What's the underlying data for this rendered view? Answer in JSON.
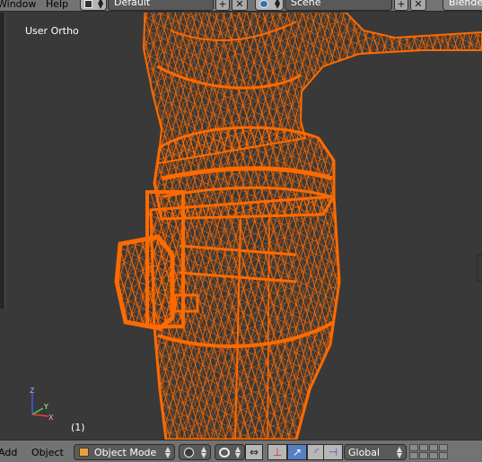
{
  "info_header": {
    "menus": [
      "Window",
      "Help"
    ],
    "layout": {
      "icon": "screen-layout-icon",
      "value": "Default"
    },
    "scene": {
      "icon": "scene-icon",
      "value": "Scene"
    },
    "add_label": "+",
    "close_label": "✕",
    "render_engine": "Blender"
  },
  "viewport": {
    "view_label": "User Ortho",
    "frame_label": "(1)",
    "axes": {
      "z": "Z",
      "y": "Y",
      "x": "X"
    },
    "wire_color": "#ff6a00",
    "background_color": "#393939"
  },
  "view3d_header": {
    "menus": [
      "Add",
      "Object"
    ],
    "mode": {
      "icon": "object-mode-cube-icon",
      "value": "Object Mode"
    },
    "viewport_shading_icon": "viewport-shading-sphere-icon",
    "pivot_icon": "pivot-point-icon",
    "manipulator_icons": [
      "manipulator-toggle-icon",
      "translate-icon",
      "rotate-icon",
      "scale-icon"
    ],
    "transform_orientation": "Global",
    "layer_count": 8
  }
}
